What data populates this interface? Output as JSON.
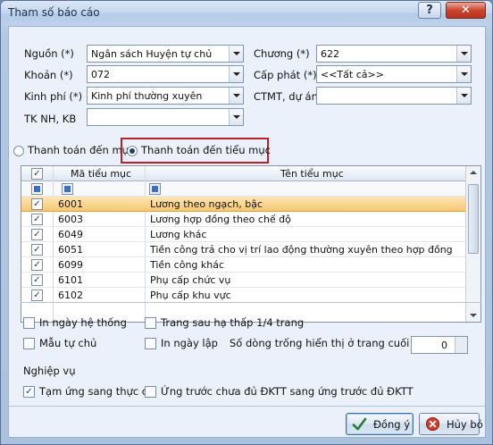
{
  "window": {
    "title": "Tham số báo cáo",
    "help": "?",
    "close": "✕"
  },
  "filters": {
    "nguon": {
      "label": "Nguồn (*)",
      "value": "Ngân sách Huyện tự chủ"
    },
    "khoan": {
      "label": "Khoản (*)",
      "value": "072"
    },
    "kinh_phi": {
      "label": "Kinh phí (*)",
      "value": "Kinh phí thường xuyên"
    },
    "tk_nh_kb": {
      "label": "TK NH, KB",
      "value": ""
    },
    "chuong": {
      "label": "Chương (*)",
      "value": "622"
    },
    "cap_phat": {
      "label": "Cấp phát (*)",
      "value": "<<Tất cả>>"
    },
    "ctmt": {
      "label": "CTMT, dự án",
      "value": ""
    }
  },
  "mode": {
    "option_muc": "Thanh toán đến mục",
    "option_tieu_muc": "Thanh toán đến tiểu mục",
    "selected": "tieu_muc"
  },
  "grid": {
    "col_code": "Mã tiểu mục",
    "col_name": "Tên tiểu mục",
    "rows": [
      {
        "code": "6001",
        "name": "Lương theo ngạch, bậc",
        "checked": true,
        "selected": true
      },
      {
        "code": "6003",
        "name": "Lương hợp đồng theo chế độ",
        "checked": true,
        "selected": false
      },
      {
        "code": "6049",
        "name": "Lương khác",
        "checked": true,
        "selected": false
      },
      {
        "code": "6051",
        "name": "Tiền công trả cho vị trí lao động thường xuyên theo hợp đồng",
        "checked": true,
        "selected": false
      },
      {
        "code": "6099",
        "name": "Tiền công khác",
        "checked": true,
        "selected": false
      },
      {
        "code": "6101",
        "name": "Phụ cấp chức vụ",
        "checked": true,
        "selected": false
      },
      {
        "code": "6102",
        "name": "Phụ cấp khu vực",
        "checked": true,
        "selected": false
      }
    ]
  },
  "options": {
    "in_ngay_he_thong": "In ngày hệ thống",
    "trang_sau_ha_thap": "Trang sau hạ thấp 1/4 trang",
    "mau_tu_chu": "Mẫu tự chủ",
    "in_ngay_lap": "In ngày lập",
    "so_dong_trong_label": "Số dòng trống hiển thị ở trang cuối cùng",
    "so_dong_trong_value": "0"
  },
  "nghiep_vu": {
    "title": "Nghiệp vụ",
    "tam_ung": "Tạm ứng sang thực chi",
    "ung_truoc": "Ứng trước chưa đủ ĐKTT sang ứng trước đủ ĐKTT"
  },
  "buttons": {
    "ok": "Đồng ý",
    "cancel": "Hủy bỏ"
  },
  "colors": {
    "accent": "#f8c871",
    "highlight_box": "#b8202b",
    "close_red": "#c9452f"
  }
}
